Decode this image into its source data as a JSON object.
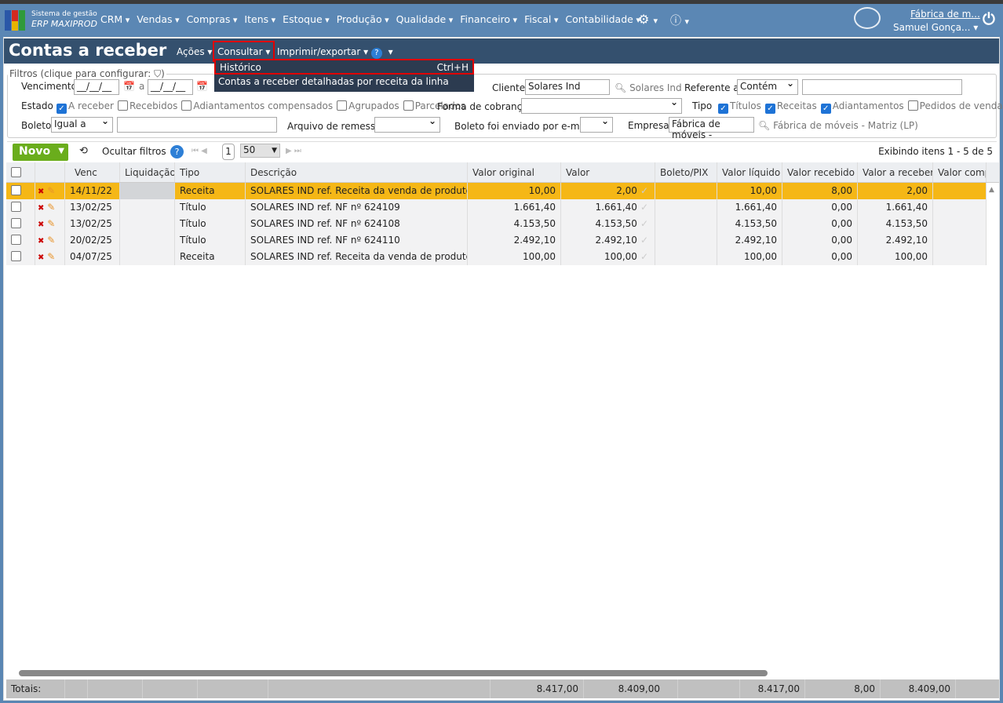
{
  "app": {
    "brand_line1": "Sistema de gestão",
    "brand_line2": "ERP MAXIPROD",
    "company_link": "Fábrica de m...",
    "user": "Samuel Gonça..."
  },
  "nav": [
    "CRM",
    "Vendas",
    "Compras",
    "Itens",
    "Estoque",
    "Produção",
    "Qualidade",
    "Financeiro",
    "Fiscal",
    "Contabilidade"
  ],
  "page": {
    "title": "Contas a receber",
    "menu": {
      "acoes": "Ações",
      "consultar": "Consultar",
      "imprimir": "Imprimir/exportar"
    }
  },
  "dropdown": {
    "items": [
      {
        "label": "Histórico",
        "shortcut": "Ctrl+H"
      },
      {
        "label": "Contas a receber detalhadas por receita da linha apontada",
        "shortcut": ""
      }
    ]
  },
  "filters": {
    "legend": "Filtros (clique para configurar:",
    "vencimento": "Vencimento",
    "date_placeholder": "__/__/__",
    "a": "a",
    "cliente": "Cliente",
    "cliente_value": "Solares Ind",
    "cliente_lookup": "Solares Ind",
    "referente": "Referente a",
    "referente_value": "Contém",
    "estado": "Estado",
    "estado_opts": [
      {
        "label": "A receber",
        "checked": true
      },
      {
        "label": "Recebidos",
        "checked": false
      },
      {
        "label": "Adiantamentos compensados",
        "checked": false
      },
      {
        "label": "Agrupados",
        "checked": false
      },
      {
        "label": "Parcelados",
        "checked": false
      }
    ],
    "forma": "Forma de cobrança",
    "tipo": "Tipo",
    "tipo_opts": [
      {
        "label": "Títulos",
        "checked": true
      },
      {
        "label": "Receitas",
        "checked": true
      },
      {
        "label": "Adiantamentos",
        "checked": true
      },
      {
        "label": "Pedidos de venda",
        "checked": false
      }
    ],
    "boleto": "Boleto",
    "boleto_value": "Igual a",
    "arquivo": "Arquivo de remessa",
    "enviado": "Boleto foi enviado por e-mail",
    "empresa": "Empresa",
    "empresa_value": "Fábrica de móveis -",
    "empresa_lookup": "Fábrica de móveis - Matriz (LP)"
  },
  "toolbar": {
    "novo": "Novo",
    "ocultar": "Ocultar filtros",
    "page": "1",
    "page_size": "50",
    "showing": "Exibindo itens 1 - 5 de 5"
  },
  "table": {
    "columns": [
      "Venc",
      "Liquidação",
      "Tipo",
      "Descrição",
      "Valor original",
      "Valor",
      "Boleto/PIX",
      "Valor líquido",
      "Valor recebido",
      "Valor a receber",
      "Valor compe"
    ],
    "rows": [
      {
        "venc": "14/11/22",
        "liq": "",
        "tipo": "Receita",
        "desc": "SOLARES IND ref. Receita da venda de produto...",
        "vorig": "10,00",
        "valor": "2,00",
        "boleto": "",
        "vliq": "10,00",
        "vrec": "8,00",
        "varec": "2,00"
      },
      {
        "venc": "13/02/25",
        "liq": "",
        "tipo": "Título",
        "desc": "SOLARES IND ref. NF nº 624109",
        "vorig": "1.661,40",
        "valor": "1.661,40",
        "boleto": "",
        "vliq": "1.661,40",
        "vrec": "0,00",
        "varec": "1.661,40"
      },
      {
        "venc": "13/02/25",
        "liq": "",
        "tipo": "Título",
        "desc": "SOLARES IND ref. NF nº 624108",
        "vorig": "4.153,50",
        "valor": "4.153,50",
        "boleto": "",
        "vliq": "4.153,50",
        "vrec": "0,00",
        "varec": "4.153,50"
      },
      {
        "venc": "20/02/25",
        "liq": "",
        "tipo": "Título",
        "desc": "SOLARES IND ref. NF nº 624110",
        "vorig": "2.492,10",
        "valor": "2.492,10",
        "boleto": "",
        "vliq": "2.492,10",
        "vrec": "0,00",
        "varec": "2.492,10"
      },
      {
        "venc": "04/07/25",
        "liq": "",
        "tipo": "Receita",
        "desc": "SOLARES IND ref. Receita da venda de produto...",
        "vorig": "100,00",
        "valor": "100,00",
        "boleto": "",
        "vliq": "100,00",
        "vrec": "0,00",
        "varec": "100,00"
      }
    ],
    "totals": {
      "label": "Totais:",
      "vorig": "8.417,00",
      "valor": "8.409,00",
      "vliq": "8.417,00",
      "vrec": "8,00",
      "varec": "8.409,00"
    }
  }
}
